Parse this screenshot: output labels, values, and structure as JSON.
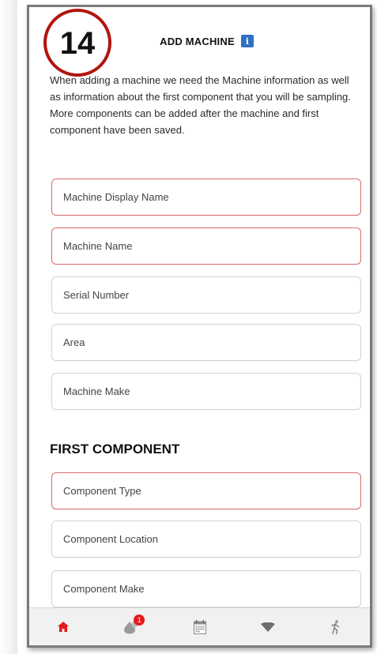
{
  "step_number": "14",
  "header": {
    "title": "ADD MACHINE",
    "info_icon": "i"
  },
  "intro_text": "When adding a machine we need the Machine information as well as information about the first component that you will be sampling. More components can be added after the machine and first component have been saved.",
  "machine_fields": {
    "display_name": {
      "placeholder": "Machine Display Name"
    },
    "name": {
      "placeholder": "Machine Name"
    },
    "serial": {
      "placeholder": "Serial Number"
    },
    "area": {
      "placeholder": "Area"
    },
    "make": {
      "placeholder": "Machine Make"
    }
  },
  "component_section": {
    "title": "FIRST COMPONENT",
    "type": {
      "placeholder": "Component Type"
    },
    "location": {
      "placeholder": "Component Location"
    },
    "make": {
      "placeholder": "Component Make"
    }
  },
  "nav": {
    "items": [
      "home-icon",
      "droplet-icon",
      "calendar-icon",
      "wifi-icon",
      "walk-icon"
    ],
    "badge": "1"
  },
  "colors": {
    "accent_red": "#e31b1b",
    "required_border": "#d86a6a",
    "badge_ring": "#b3140f",
    "info_blue": "#2f6fc4"
  }
}
